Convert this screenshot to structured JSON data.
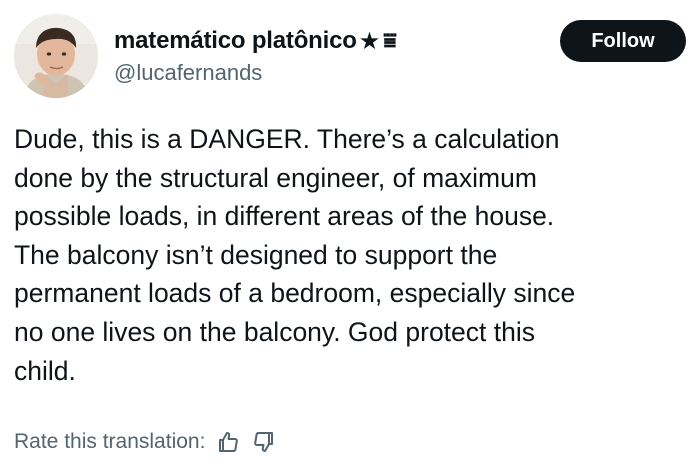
{
  "author": {
    "display_name": "matemático platônico",
    "name_star": "★",
    "name_glyph": "⩸",
    "handle": "@lucafernands",
    "avatar_icon": "user-avatar"
  },
  "actions": {
    "follow_label": "Follow"
  },
  "tweet": {
    "text": "Dude, this is a DANGER. There’s a calculation\ndone by the structural engineer, of maximum\npossible loads, in different areas of the house.\nThe balcony isn’t designed to support the\npermanent loads of a bedroom, especially since\nno one lives on the balcony. God protect this\nchild."
  },
  "translation": {
    "rate_label": "Rate this translation:",
    "thumbs_up_icon": "thumbs-up-icon",
    "thumbs_down_icon": "thumbs-down-icon"
  },
  "colors": {
    "primary_text": "#0f1419",
    "secondary_text": "#536471",
    "follow_bg": "#0f1419"
  }
}
